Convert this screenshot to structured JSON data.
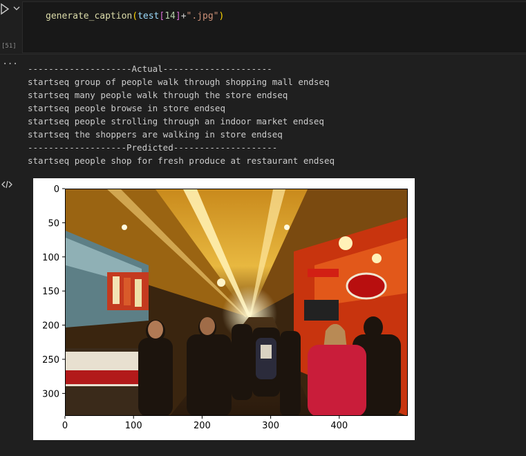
{
  "cell": {
    "execution_count": "[51]",
    "code": {
      "fn": "generate_caption",
      "open": "(",
      "var": "test",
      "lbr": "[",
      "num": "14",
      "rbr": "]",
      "op": "+",
      "str": "\".jpg\"",
      "close": ")"
    }
  },
  "output": {
    "lines": [
      "--------------------Actual---------------------",
      "startseq group of people walk through shopping mall endseq",
      "startseq many people walk through the store endseq",
      "startseq people browse in store endseq",
      "startseq people strolling through an indoor market endseq",
      "startseq the shoppers are walking in store endseq",
      "-------------------Predicted--------------------",
      "startseq people shop for fresh produce at restaurant endseq"
    ]
  },
  "figure": {
    "x_ticks": [
      "0",
      "100",
      "200",
      "300",
      "400"
    ],
    "y_ticks": [
      "0",
      "50",
      "100",
      "150",
      "200",
      "250",
      "300"
    ],
    "image_content": "market-hall-photo"
  },
  "colors": {
    "background": "#1f1f1f",
    "code_bg": "#181818",
    "text": "#cccccc"
  },
  "icons": [
    "run-icon",
    "chevron-down-icon",
    "more-dots-icon",
    "code-icon"
  ]
}
